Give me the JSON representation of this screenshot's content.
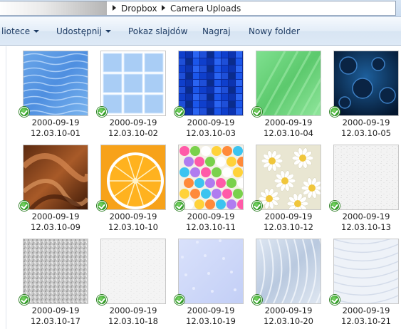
{
  "address_bar": {
    "crumbs": [
      "Dropbox",
      "Camera Uploads"
    ]
  },
  "toolbar": {
    "items": [
      {
        "label": "liotece",
        "dropdown": true
      },
      {
        "label": "Udostępnij",
        "dropdown": true
      },
      {
        "label": "Pokaz slajdów",
        "dropdown": false
      },
      {
        "label": "Nagraj",
        "dropdown": false
      },
      {
        "label": "Nowy folder",
        "dropdown": false
      }
    ]
  },
  "sync_status_icon": "green-check-icon",
  "files": [
    {
      "line1": "2000-09-19",
      "line2": "12.03.10-01",
      "pattern": "water"
    },
    {
      "line1": "2000-09-19",
      "line2": "12.03.10-02",
      "pattern": "tiles"
    },
    {
      "line1": "2000-09-19",
      "line2": "12.03.10-03",
      "pattern": "blue-mosaic"
    },
    {
      "line1": "2000-09-19",
      "line2": "12.03.10-04",
      "pattern": "green"
    },
    {
      "line1": "2000-09-19",
      "line2": "12.03.10-05",
      "pattern": "dark-blue-drops"
    },
    {
      "line1": "2000-09-19",
      "line2": "12.03.10-09",
      "pattern": "chocolate-swirl"
    },
    {
      "line1": "2000-09-19",
      "line2": "12.03.10-10",
      "pattern": "orange-slice"
    },
    {
      "line1": "2000-09-19",
      "line2": "12.03.10-11",
      "pattern": "confetti"
    },
    {
      "line1": "2000-09-19",
      "line2": "12.03.10-12",
      "pattern": "daisies"
    },
    {
      "line1": "2000-09-19",
      "line2": "12.03.10-13",
      "pattern": "white-paper"
    },
    {
      "line1": "2000-09-19",
      "line2": "12.03.10-17",
      "pattern": "gray-noise"
    },
    {
      "line1": "2000-09-19",
      "line2": "12.03.10-18",
      "pattern": "white-texture"
    },
    {
      "line1": "2000-09-19",
      "line2": "12.03.10-19",
      "pattern": "lavender"
    },
    {
      "line1": "2000-09-19",
      "line2": "12.03.10-20",
      "pattern": "frost"
    },
    {
      "line1": "2000-09-19",
      "line2": "12.03.10-21",
      "pattern": "light-frost"
    }
  ]
}
